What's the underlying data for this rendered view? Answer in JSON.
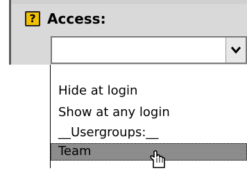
{
  "field": {
    "help_glyph": "?",
    "label": "Access:",
    "selected_value": ""
  },
  "dropdown": {
    "options": [
      "",
      "Hide at login",
      "Show at any login",
      "__Usergroups:__",
      "Team"
    ],
    "highlighted": "Team"
  },
  "icons": {
    "help": "help-icon",
    "arrow": "chevron-down-icon",
    "cursor": "hand-pointer-cursor-icon"
  },
  "colors": {
    "panel": "#d9d9d9",
    "help_yellow": "#f2c200",
    "highlight": "#8c8c8c",
    "text": "#000000"
  }
}
